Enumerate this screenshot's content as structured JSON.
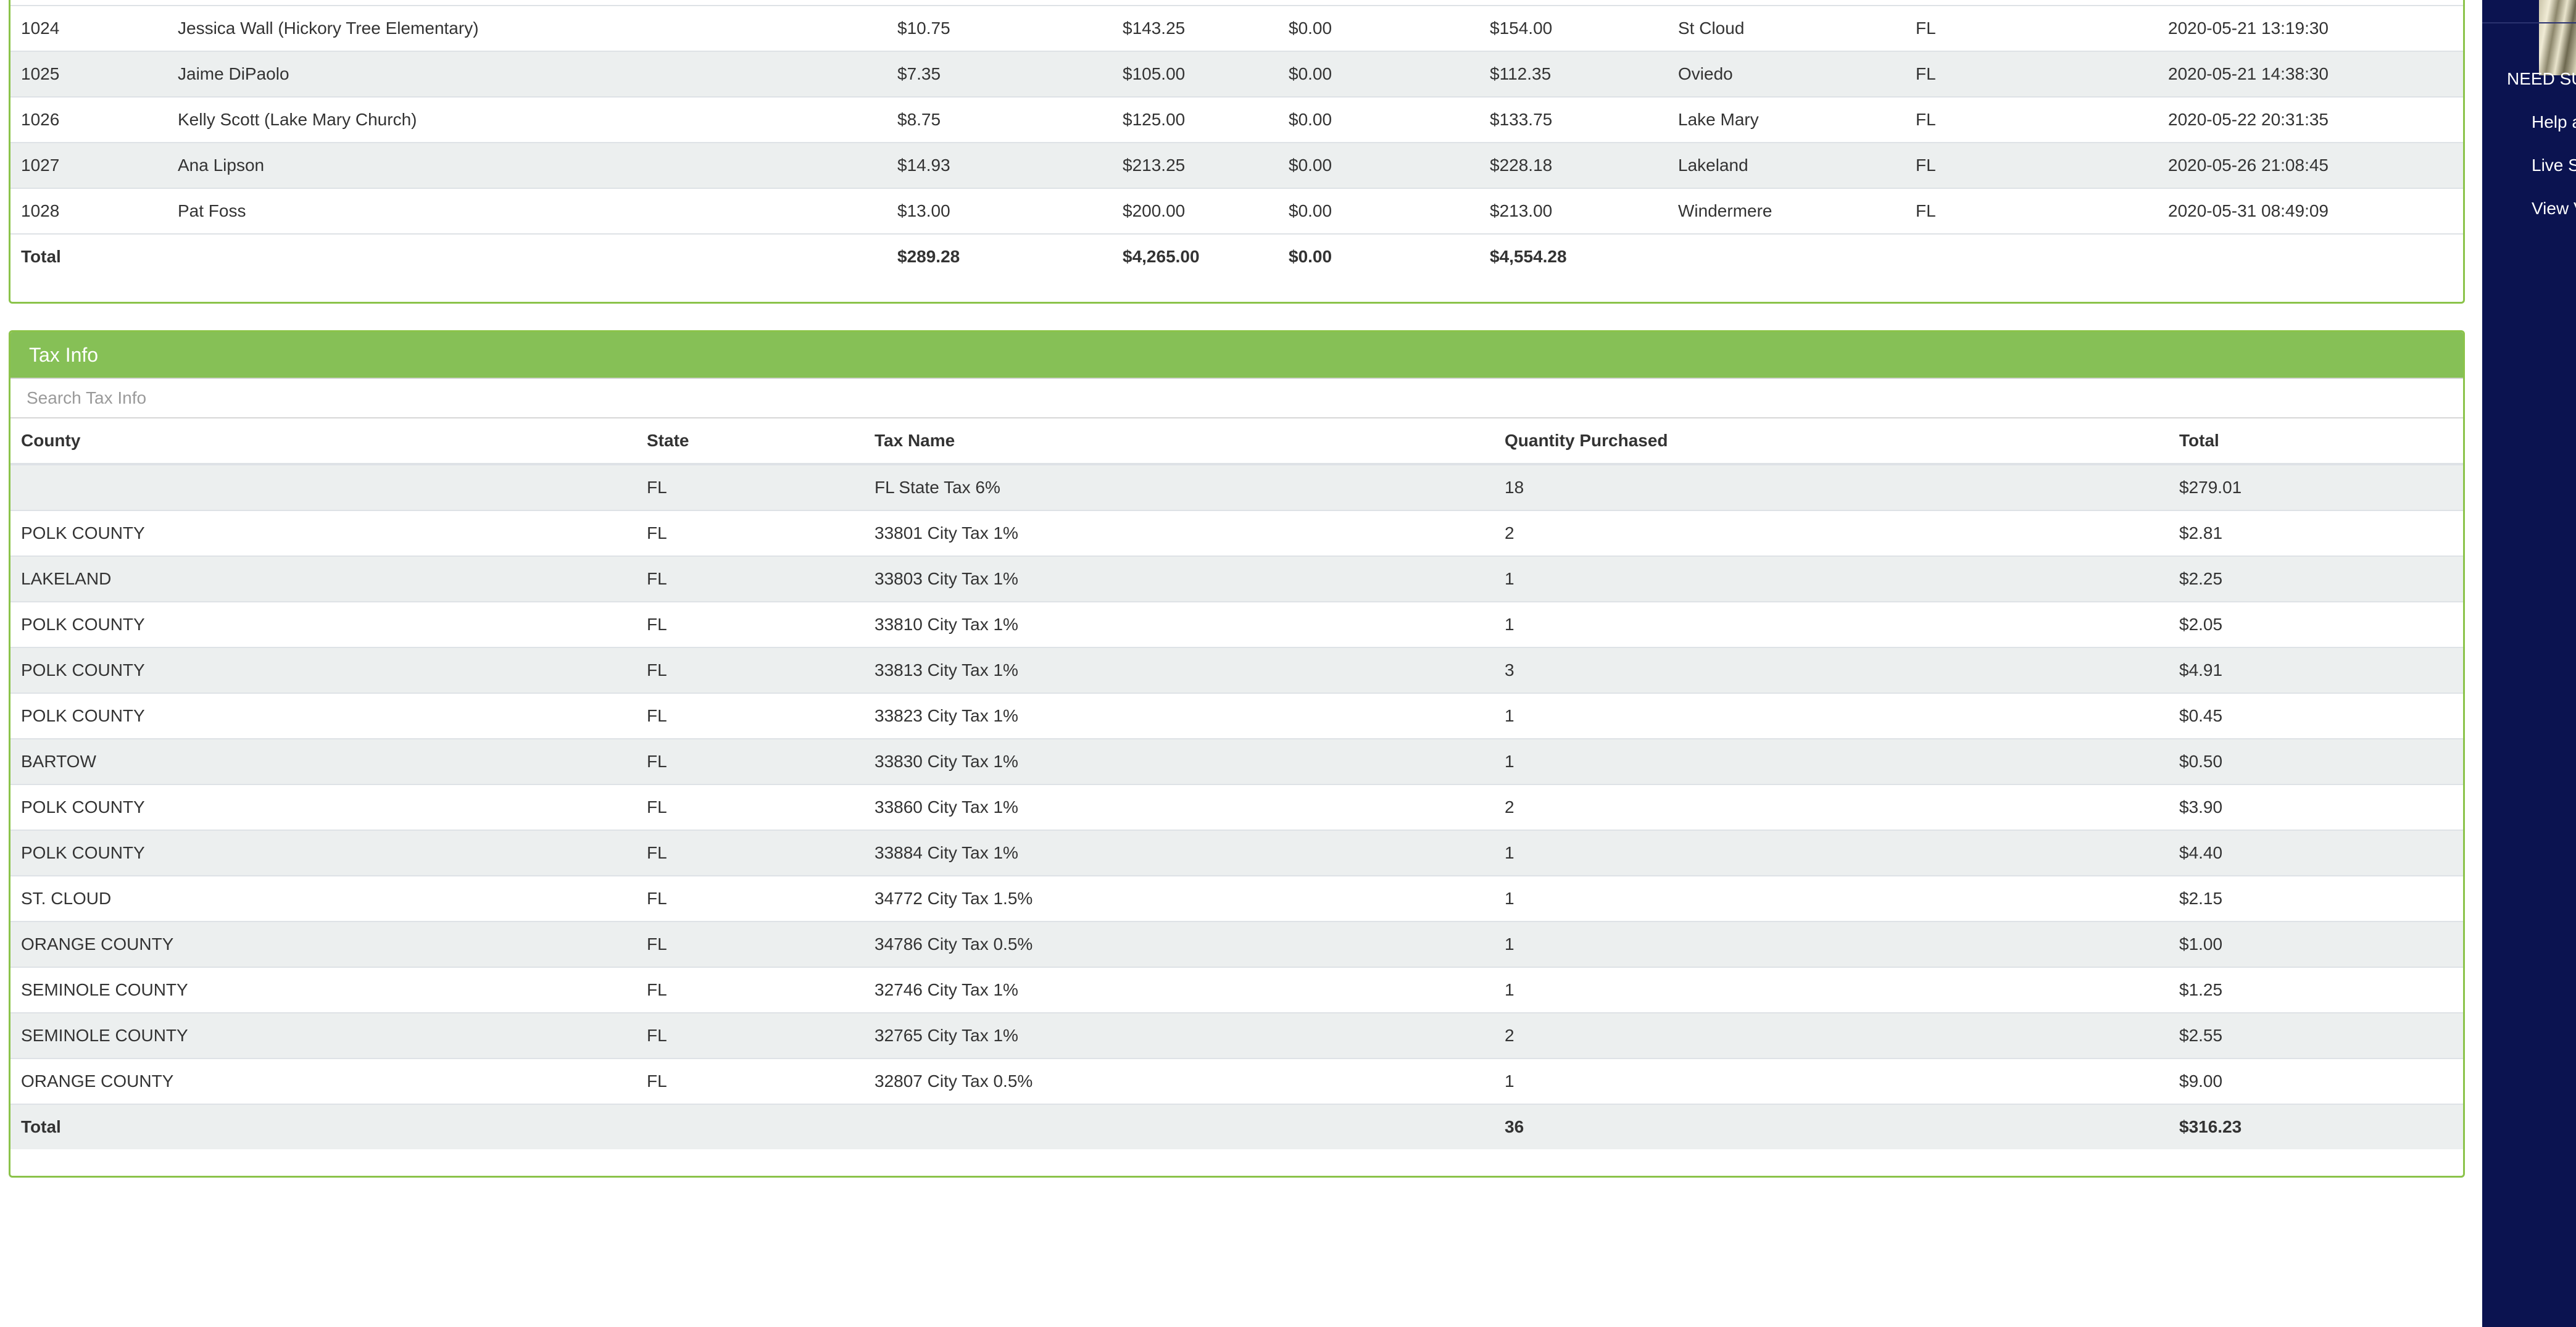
{
  "orders": {
    "rows": [
      {
        "id": "1024",
        "name": "Jessica Wall (Hickory Tree Elementary)",
        "tax": "$10.75",
        "subtotal": "$143.25",
        "discount": "$0.00",
        "total": "$154.00",
        "city": "St Cloud",
        "state": "FL",
        "date": "2020-05-21 13:19:30"
      },
      {
        "id": "1025",
        "name": "Jaime DiPaolo",
        "tax": "$7.35",
        "subtotal": "$105.00",
        "discount": "$0.00",
        "total": "$112.35",
        "city": "Oviedo",
        "state": "FL",
        "date": "2020-05-21 14:38:30"
      },
      {
        "id": "1026",
        "name": "Kelly Scott (Lake Mary Church)",
        "tax": "$8.75",
        "subtotal": "$125.00",
        "discount": "$0.00",
        "total": "$133.75",
        "city": "Lake Mary",
        "state": "FL",
        "date": "2020-05-22 20:31:35"
      },
      {
        "id": "1027",
        "name": "Ana Lipson",
        "tax": "$14.93",
        "subtotal": "$213.25",
        "discount": "$0.00",
        "total": "$228.18",
        "city": "Lakeland",
        "state": "FL",
        "date": "2020-05-26 21:08:45"
      },
      {
        "id": "1028",
        "name": "Pat Foss",
        "tax": "$13.00",
        "subtotal": "$200.00",
        "discount": "$0.00",
        "total": "$213.00",
        "city": "Windermere",
        "state": "FL",
        "date": "2020-05-31 08:49:09"
      }
    ],
    "total": {
      "label": "Total",
      "tax": "$289.28",
      "subtotal": "$4,265.00",
      "discount": "$0.00",
      "total": "$4,554.28"
    }
  },
  "tax_info": {
    "title": "Tax Info",
    "search_placeholder": "Search Tax Info",
    "headers": {
      "county": "County",
      "state": "State",
      "tax_name": "Tax Name",
      "quantity": "Quantity Purchased",
      "total": "Total"
    },
    "rows": [
      {
        "county": "",
        "state": "FL",
        "tax_name": "FL State Tax 6%",
        "quantity": "18",
        "total": "$279.01"
      },
      {
        "county": "POLK COUNTY",
        "state": "FL",
        "tax_name": "33801 City Tax 1%",
        "quantity": "2",
        "total": "$2.81"
      },
      {
        "county": "LAKELAND",
        "state": "FL",
        "tax_name": "33803 City Tax 1%",
        "quantity": "1",
        "total": "$2.25"
      },
      {
        "county": "POLK COUNTY",
        "state": "FL",
        "tax_name": "33810 City Tax 1%",
        "quantity": "1",
        "total": "$2.05"
      },
      {
        "county": "POLK COUNTY",
        "state": "FL",
        "tax_name": "33813 City Tax 1%",
        "quantity": "3",
        "total": "$4.91"
      },
      {
        "county": "POLK COUNTY",
        "state": "FL",
        "tax_name": "33823 City Tax 1%",
        "quantity": "1",
        "total": "$0.45"
      },
      {
        "county": "BARTOW",
        "state": "FL",
        "tax_name": "33830 City Tax 1%",
        "quantity": "1",
        "total": "$0.50"
      },
      {
        "county": "POLK COUNTY",
        "state": "FL",
        "tax_name": "33860 City Tax 1%",
        "quantity": "2",
        "total": "$3.90"
      },
      {
        "county": "POLK COUNTY",
        "state": "FL",
        "tax_name": "33884 City Tax 1%",
        "quantity": "1",
        "total": "$4.40"
      },
      {
        "county": "ST. CLOUD",
        "state": "FL",
        "tax_name": "34772 City Tax 1.5%",
        "quantity": "1",
        "total": "$2.15"
      },
      {
        "county": "ORANGE COUNTY",
        "state": "FL",
        "tax_name": "34786 City Tax 0.5%",
        "quantity": "1",
        "total": "$1.00"
      },
      {
        "county": "SEMINOLE COUNTY",
        "state": "FL",
        "tax_name": "32746 City Tax 1%",
        "quantity": "1",
        "total": "$1.25"
      },
      {
        "county": "SEMINOLE COUNTY",
        "state": "FL",
        "tax_name": "32765 City Tax 1%",
        "quantity": "2",
        "total": "$2.55"
      },
      {
        "county": "ORANGE COUNTY",
        "state": "FL",
        "tax_name": "32807 City Tax 0.5%",
        "quantity": "1",
        "total": "$9.00"
      }
    ],
    "total": {
      "label": "Total",
      "quantity": "36",
      "total": "$316.23"
    }
  },
  "sidebar": {
    "heading": "NEED SU",
    "items": [
      "Help a",
      "Live S",
      "View V"
    ]
  },
  "colors": {
    "panel_accent": "#86c056",
    "panel_border": "#8bc34a",
    "row_alt": "#ecefef",
    "sidebar_bg": "#0b1350"
  }
}
